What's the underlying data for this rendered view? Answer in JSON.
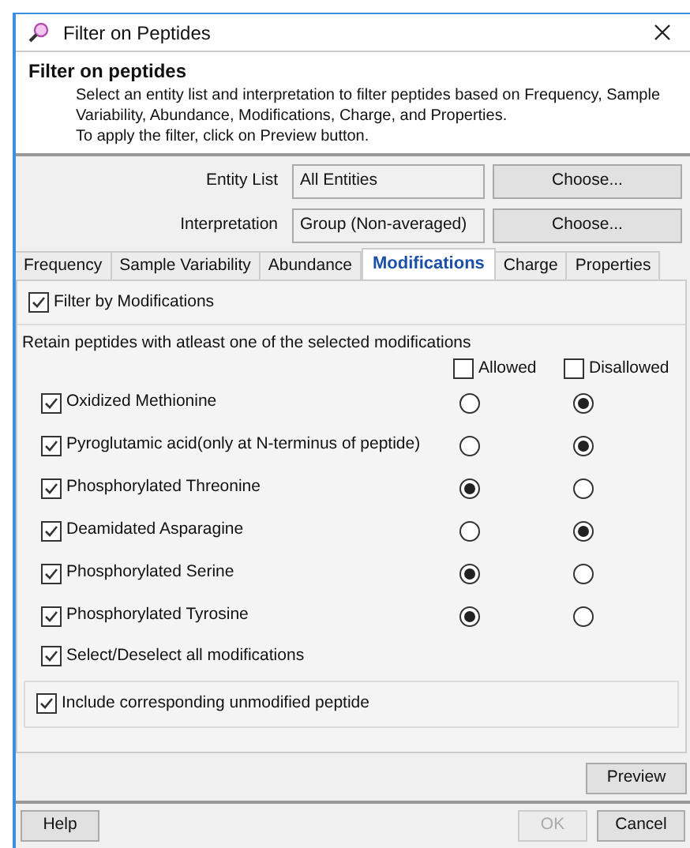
{
  "window": {
    "title": "Filter on Peptides"
  },
  "header": {
    "title": "Filter on peptides",
    "description": [
      "Select an entity list and interpretation to filter peptides based on Frequency, Sample Variability, Abundance, Modifications, Charge, and Properties.",
      "To apply the filter, click on Preview button."
    ]
  },
  "fields": [
    {
      "label": "Entity List",
      "value": "All Entities",
      "button": "Choose..."
    },
    {
      "label": "Interpretation",
      "value": "Group (Non-averaged)",
      "button": "Choose..."
    }
  ],
  "tabs": [
    {
      "label": "Frequency",
      "selected": false
    },
    {
      "label": "Sample Variability",
      "selected": false
    },
    {
      "label": "Abundance",
      "selected": false
    },
    {
      "label": "Modifications",
      "selected": true
    },
    {
      "label": "Charge",
      "selected": false
    },
    {
      "label": "Properties",
      "selected": false
    }
  ],
  "filter_by": {
    "label": "Filter by Modifications",
    "checked": true
  },
  "retain_label": "Retain peptides with atleast one of the selected modifications",
  "columns": [
    {
      "label": "Allowed",
      "checked": false
    },
    {
      "label": "Disallowed",
      "checked": false
    }
  ],
  "modifications": [
    {
      "name": "Oxidized Methionine",
      "checked": true,
      "options": [
        {
          "selected": false
        },
        {
          "selected": true
        }
      ]
    },
    {
      "name": "Pyroglutamic acid(only at N-terminus of peptide)",
      "checked": true,
      "options": [
        {
          "selected": false
        },
        {
          "selected": true
        }
      ]
    },
    {
      "name": "Phosphorylated Threonine",
      "checked": true,
      "options": [
        {
          "selected": true
        },
        {
          "selected": false
        }
      ]
    },
    {
      "name": "Deamidated Asparagine",
      "checked": true,
      "options": [
        {
          "selected": false
        },
        {
          "selected": true
        }
      ]
    },
    {
      "name": "Phosphorylated Serine",
      "checked": true,
      "options": [
        {
          "selected": true
        },
        {
          "selected": false
        }
      ]
    },
    {
      "name": "Phosphorylated Tyrosine",
      "checked": true,
      "options": [
        {
          "selected": true
        },
        {
          "selected": false
        }
      ]
    }
  ],
  "select_all": {
    "label": "Select/Deselect all modifications",
    "checked": true
  },
  "include_unmodified": {
    "label": "Include corresponding unmodified peptide",
    "checked": true
  },
  "preview_button": "Preview",
  "footer": {
    "help": "Help",
    "ok": {
      "label": "OK",
      "disabled": true
    },
    "cancel": "Cancel"
  }
}
